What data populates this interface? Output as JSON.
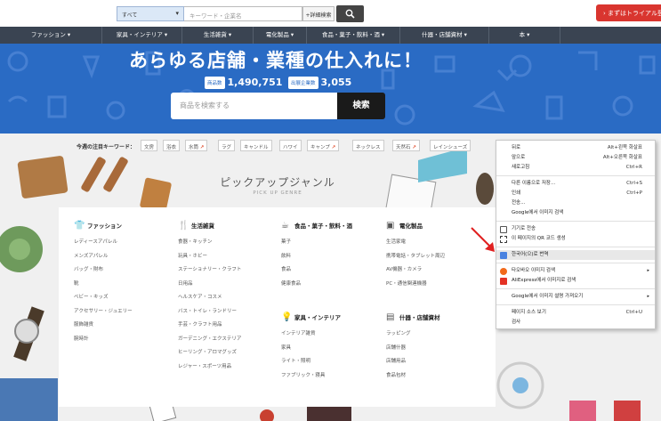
{
  "topbar": {
    "category_select": "すべて",
    "keyword_placeholder": "キーワード・企業名",
    "advanced_search": "+詳細検索",
    "trial_button": "› まずはトライアル登録"
  },
  "nav": {
    "items": [
      {
        "label": "ファッション ▾"
      },
      {
        "label": "家具・インテリア ▾"
      },
      {
        "label": "生活雑貨 ▾"
      },
      {
        "label": "電化製品 ▾"
      },
      {
        "label": "食品・菓子・飲料・酒 ▾"
      },
      {
        "label": "什器・店舗資材 ▾"
      },
      {
        "label": "本 ▾"
      }
    ]
  },
  "hero": {
    "title": "あらゆる店舗・業種の仕入れに！",
    "products_label": "商品数",
    "products_value": "1,490,751",
    "companies_label": "出展企業数",
    "companies_value": "3,055",
    "search_placeholder": "商品を検索する",
    "search_button": "検索"
  },
  "keywords": {
    "label": "今週の注目キーワード：",
    "chips": [
      {
        "text": "文房",
        "trend": ""
      },
      {
        "text": "浴衣",
        "trend": ""
      },
      {
        "text": "水筒",
        "trend": "↗"
      },
      {
        "text": "ラグ",
        "trend": ""
      },
      {
        "text": "キャンドル",
        "trend": ""
      },
      {
        "text": "ハワイ",
        "trend": ""
      },
      {
        "text": "キャンプ",
        "trend": "↗"
      },
      {
        "text": "ネックレス",
        "trend": ""
      },
      {
        "text": "天然石",
        "trend": "↗"
      },
      {
        "text": "レインシューズ",
        "trend": ""
      }
    ]
  },
  "pickup": {
    "title": "ピックアップジャンル",
    "subtitle": "PICK UP GENRE"
  },
  "genres": {
    "fashion": {
      "icon": "shirt-icon",
      "title": "ファッション",
      "items": [
        "レディースアパレル",
        "メンズアパレル",
        "バッグ・財布",
        "靴",
        "ベビー・キッズ",
        "アクセサリー・ジュエリー",
        "服飾雑貨",
        "腕時計"
      ]
    },
    "daily": {
      "icon": "cutlery-icon",
      "title": "生活雑貨",
      "items": [
        "食器・キッチン",
        "玩具・ホビー",
        "ステーショナリー・クラフト",
        "日用品",
        "ヘルスケア・コスメ",
        "バス・トイレ・ランドリー",
        "手芸・クラフト用品",
        "ガーデニング・エクステリア",
        "ヒーリング・アロマグッズ",
        "レジャー・スポーツ用品"
      ]
    },
    "food": {
      "icon": "cup-icon",
      "title": "食品・菓子・飲料・酒",
      "items": [
        "菓子",
        "飲料",
        "食品",
        "健康食品"
      ]
    },
    "electric": {
      "icon": "appliance-icon",
      "title": "電化製品",
      "items": [
        "生活家電",
        "携帯電話・タブレット周辺",
        "AV機器・カメラ",
        "PC・通信関連機器"
      ]
    },
    "furniture": {
      "icon": "lamp-icon",
      "title": "家具・インテリア",
      "items": [
        "インテリア雑貨",
        "家具",
        "ライト・照明",
        "ファブリック・寝具"
      ]
    },
    "fixtures": {
      "icon": "shelf-icon",
      "title": "什器・店舗資材",
      "items": [
        "ラッピング",
        "店舗什器",
        "店舗用品",
        "食品包材"
      ]
    }
  },
  "context_menu": {
    "items": [
      {
        "label": "뒤로",
        "shortcut": "Alt+왼쪽 화살표"
      },
      {
        "label": "앞으로",
        "shortcut": "Alt+오른쪽 화살표"
      },
      {
        "label": "새로고침",
        "shortcut": "Ctrl+R"
      },
      {
        "label": "다른 이름으로 저장...",
        "shortcut": "Ctrl+S"
      },
      {
        "label": "인쇄",
        "shortcut": "Ctrl+P"
      },
      {
        "label": "전송...",
        "shortcut": ""
      },
      {
        "label": "Google에서 이미지 검색",
        "shortcut": ""
      },
      {
        "label": "기기로 전송",
        "shortcut": ""
      },
      {
        "label": "이 페이지의 QR 코드 생성",
        "shortcut": ""
      },
      {
        "label": "한국어(으)로 번역",
        "shortcut": ""
      },
      {
        "label": "타오바오 이미지 검색",
        "shortcut": "▸"
      },
      {
        "label": "AliExpress에서 이미지로 검색",
        "shortcut": ""
      },
      {
        "label": "Google에서 이미지 설명 가져오기",
        "shortcut": "▸"
      },
      {
        "label": "페이지 소스 보기",
        "shortcut": "Ctrl+U"
      },
      {
        "label": "검사",
        "shortcut": ""
      }
    ]
  },
  "colors": {
    "hero_blue": "#2a6bc4",
    "nav_dark": "#3a4452",
    "trial_red": "#d9352f",
    "arrow_red": "#e02020"
  }
}
